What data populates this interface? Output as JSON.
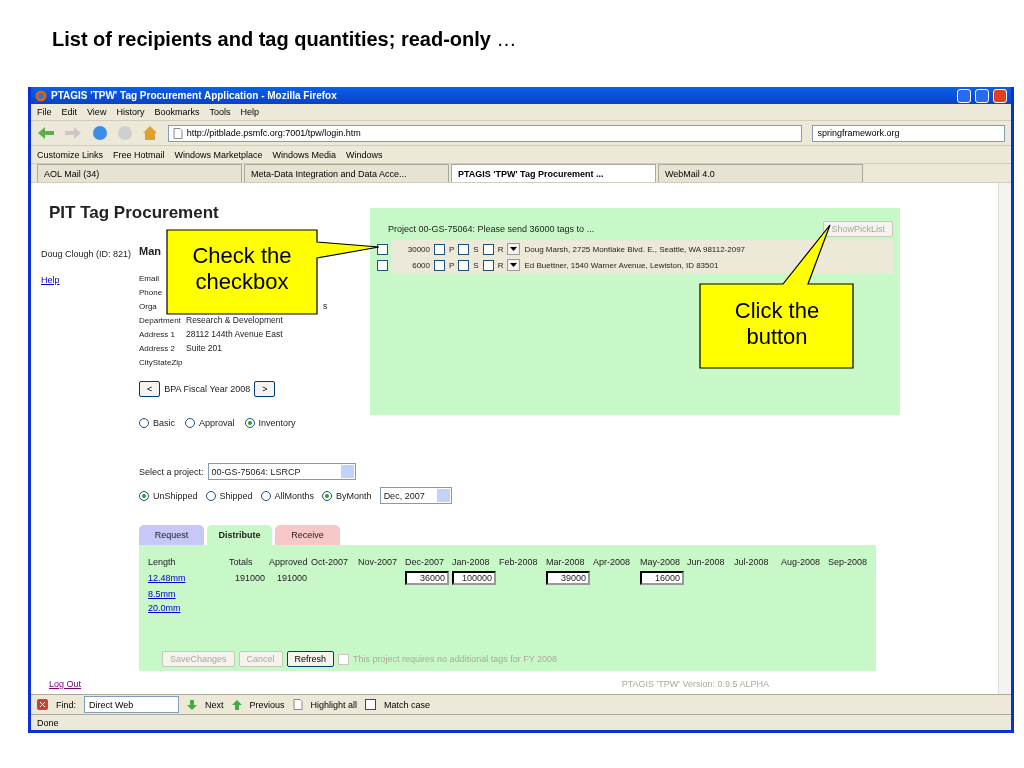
{
  "slide_heading": "**List of recipients and tag quantities; read-only** …",
  "window": {
    "title": "PTAGIS 'TPW' Tag Procurement Application - Mozilla Firefox"
  },
  "menu": [
    "File",
    "Edit",
    "View",
    "History",
    "Bookmarks",
    "Tools",
    "Help"
  ],
  "address": "http://pitblade.psmfc.org:7001/tpw/login.htm",
  "search": "springframework.org",
  "bookmarks": [
    "Customize Links",
    "Free Hotmail",
    "Windows Marketplace",
    "Windows Media",
    "Windows"
  ],
  "tabs": [
    {
      "label": "AOL Mail (34)",
      "selected": false
    },
    {
      "label": "Meta-Data Integration and Data Acce...",
      "selected": false
    },
    {
      "label": "PTAGIS 'TPW' Tag Procurement ...",
      "selected": true
    },
    {
      "label": "WebMail 4.0",
      "selected": false
    }
  ],
  "page": {
    "title": "PIT Tag Procurement",
    "user": "Doug Clough (ID: 821)",
    "help": "Help",
    "section": "Man",
    "fields": [
      {
        "label": "Email"
      },
      {
        "label": "Phone"
      },
      {
        "label": "Orga",
        "value": "s",
        "covered": true
      },
      {
        "label": "Department",
        "value": "Research & Development"
      },
      {
        "label": "Address 1",
        "value": "28112 144th Avenue East"
      },
      {
        "label": "Address 2",
        "value": "Suite 201"
      },
      {
        "label": "CityStateZip"
      }
    ],
    "prev": "<",
    "fiscal_year": "BPA Fiscal Year 2008",
    "next": ">",
    "modes": [
      {
        "label": "Basic",
        "selected": false
      },
      {
        "label": "Approval",
        "selected": false
      },
      {
        "label": "Inventory",
        "selected": true
      }
    ],
    "project_label": "Select a project:",
    "project": "00-GS-75064: LSRCP",
    "filters": [
      {
        "label": "UnShipped",
        "selected": true
      },
      {
        "label": "Shipped",
        "selected": false
      },
      {
        "label": "AllMonths",
        "selected": false
      },
      {
        "label": "ByMonth",
        "selected": true
      }
    ],
    "month": "Dec, 2007",
    "sections": [
      {
        "label": "Request",
        "selected": false,
        "color": "#c8c8f8"
      },
      {
        "label": "Distribute",
        "selected": true,
        "color": "#c8f8c8"
      },
      {
        "label": "Receive",
        "selected": false,
        "color": "#f8c8c8"
      }
    ],
    "columns": [
      "Length",
      "Totals",
      "Approved",
      "Oct-2007",
      "Nov-2007",
      "Dec-2007",
      "Jan-2008",
      "Feb-2008",
      "Mar-2008",
      "Apr-2008",
      "May-2008",
      "Jun-2008",
      "Jul-2008",
      "Aug-2008",
      "Sep-2008"
    ],
    "rows": [
      {
        "cells": [
          {
            "kind": "link",
            "value": "12.48mm"
          },
          {
            "kind": "text",
            "value": "191000"
          },
          {
            "kind": "text",
            "value": "191000"
          },
          {
            "kind": "empty"
          },
          {
            "kind": "empty"
          },
          {
            "kind": "input",
            "value": "36000"
          },
          {
            "kind": "input",
            "value": "100000"
          },
          {
            "kind": "empty"
          },
          {
            "kind": "input",
            "value": "39000"
          },
          {
            "kind": "empty"
          },
          {
            "kind": "input",
            "value": "16000"
          }
        ]
      },
      {
        "cells": [
          {
            "kind": "link",
            "value": "8.5mm"
          }
        ]
      },
      {
        "cells": [
          {
            "kind": "link",
            "value": "20.0mm"
          }
        ]
      }
    ],
    "actions": [
      {
        "label": "SaveChanges",
        "disabled": true
      },
      {
        "label": "Cancel",
        "disabled": true
      },
      {
        "label": "Refresh",
        "disabled": false
      }
    ],
    "no_tags": {
      "label": "This project requires no additional tags for FY 2008",
      "checked": false,
      "disabled": true
    },
    "logout": "Log Out",
    "version": "PTAGIS 'TPW' Version: 0.9.5 ALPHA"
  },
  "popup": {
    "message": "Project 00-GS-75064: Please send 36000 tags to ...",
    "button": {
      "label": "ShowPickList",
      "disabled": true
    },
    "recipients": [
      {
        "checked": false,
        "quantity": "30000",
        "address": "Doug Marsh, 2725 Montlake Blvd. E., Seattle, WA 98112-2097",
        "flags": [
          {
            "label": "P",
            "checked": false
          },
          {
            "label": "S",
            "checked": false
          },
          {
            "label": "R",
            "checked": false
          }
        ]
      },
      {
        "checked": false,
        "quantity": "6000",
        "address": "Ed Buettner, 1540 Warner Avenue, Lewiston, ID 83501",
        "flags": [
          {
            "label": "P",
            "checked": false
          },
          {
            "label": "S",
            "checked": false
          },
          {
            "label": "R",
            "checked": false
          }
        ]
      }
    ]
  },
  "find_bar": {
    "label": "Find:",
    "value": "Direct Web",
    "next": "Next",
    "previous": "Previous",
    "highlight": "Highlight all",
    "match_case": {
      "label": "Match case",
      "checked": false
    }
  },
  "status": "Done",
  "callouts": [
    "Check the checkbox",
    "Click the button"
  ]
}
